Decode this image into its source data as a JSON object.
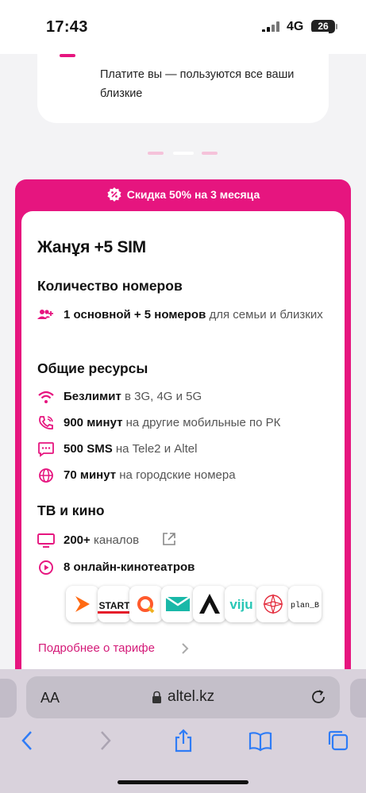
{
  "status": {
    "time": "17:43",
    "network": "4G",
    "battery": "26"
  },
  "top_card": {
    "text": "Платите вы — пользуются все ваши близкие"
  },
  "promo": {
    "label": "Скидка 50% на 3 месяца"
  },
  "plan": {
    "title": "Жанұя +5 SIM",
    "numbers_section": {
      "title": "Количество номеров",
      "bold": "1 основной + 5 номеров",
      "rest": " для семьи и близких"
    },
    "resources_section": {
      "title": "Общие ресурсы",
      "items": [
        {
          "icon": "wifi-icon",
          "bold": "Безлимит",
          "rest": " в 3G, 4G и 5G"
        },
        {
          "icon": "phone-call-icon",
          "bold": "900 минут",
          "rest": " на другие мобильные по РК"
        },
        {
          "icon": "sms-icon",
          "bold": "500 SMS",
          "rest": " на Tele2 и Altel"
        },
        {
          "icon": "globe-icon",
          "bold": "70 минут",
          "rest": " на городские номера"
        }
      ]
    },
    "tv_section": {
      "title": "ТВ и кино",
      "channels_bold": "200+",
      "channels_rest": " каналов",
      "cinemas": "8 онлайн-кинотеатров"
    },
    "logos": {
      "start": "START",
      "viju": "viju",
      "plan_b": "plan_B"
    },
    "more_link": "Подробнее о тарифе"
  },
  "browser": {
    "aa": "AA",
    "url": "altel.kz"
  },
  "colors": {
    "brand": "#e6157f",
    "link": "#d41a78",
    "browser_chrome": "#d9d2dc"
  }
}
